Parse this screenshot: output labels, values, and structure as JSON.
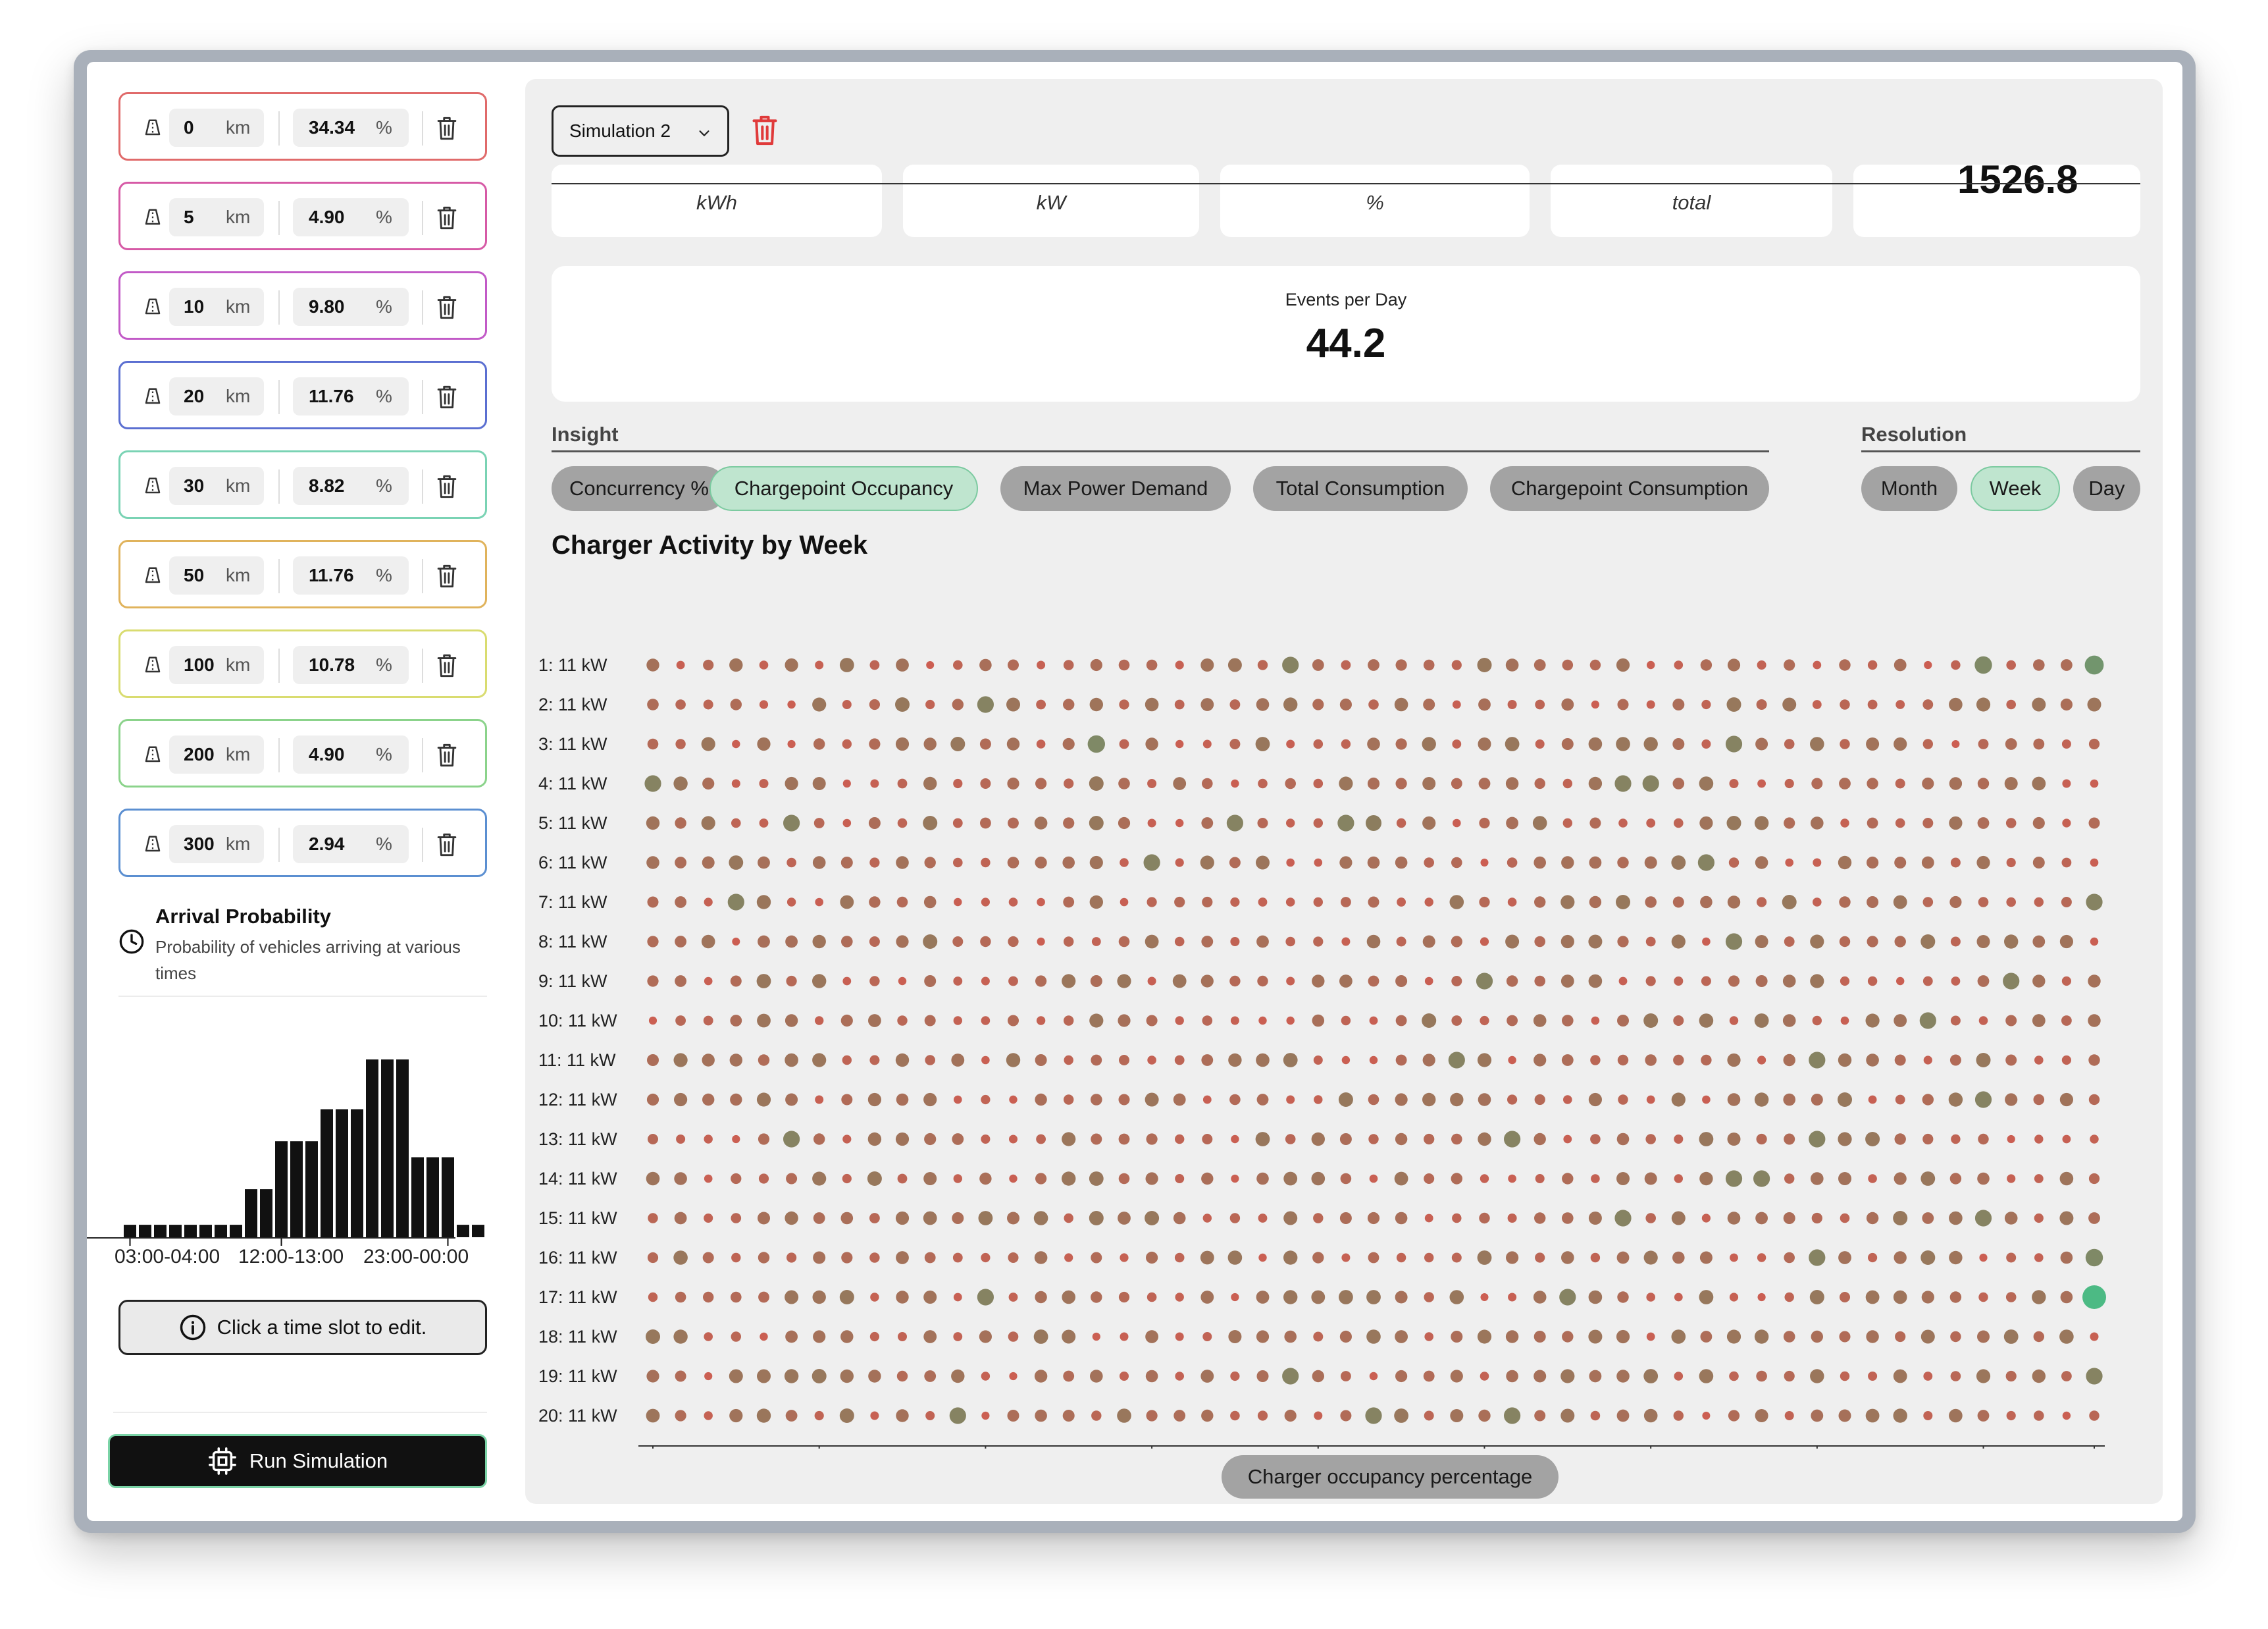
{
  "sidebar": {
    "distance_unit": "km",
    "percent_unit": "%",
    "distances": [
      {
        "km": "0",
        "pct": "34.34",
        "color": "#e06a6a"
      },
      {
        "km": "5",
        "pct": "4.90",
        "color": "#d65aa6"
      },
      {
        "km": "10",
        "pct": "9.80",
        "color": "#c25ac7"
      },
      {
        "km": "20",
        "pct": "11.76",
        "color": "#5b6fd1"
      },
      {
        "km": "30",
        "pct": "8.82",
        "color": "#7ad3b4"
      },
      {
        "km": "50",
        "pct": "11.76",
        "color": "#e0b35c"
      },
      {
        "km": "100",
        "pct": "10.78",
        "color": "#d9dc70"
      },
      {
        "km": "200",
        "pct": "4.90",
        "color": "#8bd38b"
      },
      {
        "km": "300",
        "pct": "2.94",
        "color": "#5b8fd1"
      }
    ],
    "arrival": {
      "title": "Arrival Probability",
      "description": "Probability of vehicles arriving at various times",
      "histogram": [
        0.07,
        0.07,
        0.07,
        0.07,
        0.07,
        0.07,
        0.07,
        0.07,
        0.27,
        0.27,
        0.54,
        0.54,
        0.54,
        0.72,
        0.72,
        0.72,
        1.0,
        1.0,
        1.0,
        0.45,
        0.45,
        0.45,
        0.07,
        0.07
      ],
      "tick_labels": [
        "03:00-04:00",
        "12:00-13:00",
        "23:00-00:00"
      ]
    },
    "hint": "Click a time slot to edit.",
    "run_label": "Run Simulation"
  },
  "main": {
    "simulation_select": "Simulation 2",
    "kpis": [
      "kWh",
      "kW",
      "%",
      "total"
    ],
    "kpi_big": "1526.8",
    "events": {
      "label": "Events per Day",
      "value": "44.2"
    },
    "insight": {
      "title": "Insight",
      "options": [
        "Concurrency %",
        "Chargepoint Occupancy",
        "Max Power Demand",
        "Total Consumption",
        "Chargepoint Consumption"
      ],
      "active": "Chargepoint Occupancy"
    },
    "resolution": {
      "title": "Resolution",
      "options": [
        "Month",
        "Week",
        "Day"
      ],
      "active": "Week"
    },
    "legend_label": "Charger occupancy percentage"
  },
  "chart_data": {
    "type": "scatter",
    "title": "Charger Activity by Week",
    "xlabel": "Week",
    "ylabel": "",
    "x_range": [
      1,
      53
    ],
    "x_ticks": [
      1,
      7,
      13,
      19,
      25,
      31,
      37,
      43,
      49,
      53
    ],
    "rows": [
      "1: 11 kW",
      "2: 11 kW",
      "3: 11 kW",
      "4: 11 kW",
      "5: 11 kW",
      "6: 11 kW",
      "7: 11 kW",
      "8: 11 kW",
      "9: 11 kW",
      "10: 11 kW",
      "11: 11 kW",
      "12: 11 kW",
      "13: 11 kW",
      "14: 11 kW",
      "15: 11 kW",
      "16: 11 kW",
      "17: 11 kW",
      "18: 11 kW",
      "19: 11 kW",
      "20: 11 kW"
    ],
    "colors": {
      "low": "#cc5e52",
      "mid": "#8c7d5e",
      "high": "#4cba84"
    },
    "highlights": [
      {
        "row": 1,
        "week": 53,
        "level": 0.7
      },
      {
        "row": 1,
        "week": 49,
        "level": 0.6
      },
      {
        "row": 1,
        "week": 24,
        "level": 0.55
      },
      {
        "row": 2,
        "week": 13,
        "level": 0.55
      },
      {
        "row": 3,
        "week": 17,
        "level": 0.6
      },
      {
        "row": 3,
        "week": 40,
        "level": 0.55
      },
      {
        "row": 4,
        "week": 1,
        "level": 0.55
      },
      {
        "row": 4,
        "week": 36,
        "level": 0.55
      },
      {
        "row": 4,
        "week": 37,
        "level": 0.55
      },
      {
        "row": 5,
        "week": 6,
        "level": 0.55
      },
      {
        "row": 5,
        "week": 22,
        "level": 0.55
      },
      {
        "row": 5,
        "week": 26,
        "level": 0.55
      },
      {
        "row": 5,
        "week": 27,
        "level": 0.5
      },
      {
        "row": 6,
        "week": 19,
        "level": 0.55
      },
      {
        "row": 6,
        "week": 39,
        "level": 0.55
      },
      {
        "row": 7,
        "week": 4,
        "level": 0.55
      },
      {
        "row": 7,
        "week": 53,
        "level": 0.55
      },
      {
        "row": 8,
        "week": 40,
        "level": 0.55
      },
      {
        "row": 9,
        "week": 31,
        "level": 0.55
      },
      {
        "row": 9,
        "week": 50,
        "level": 0.55
      },
      {
        "row": 10,
        "week": 47,
        "level": 0.55
      },
      {
        "row": 11,
        "week": 30,
        "level": 0.55
      },
      {
        "row": 11,
        "week": 43,
        "level": 0.55
      },
      {
        "row": 12,
        "week": 49,
        "level": 0.55
      },
      {
        "row": 13,
        "week": 6,
        "level": 0.55
      },
      {
        "row": 13,
        "week": 32,
        "level": 0.55
      },
      {
        "row": 13,
        "week": 43,
        "level": 0.55
      },
      {
        "row": 14,
        "week": 40,
        "level": 0.55
      },
      {
        "row": 14,
        "week": 41,
        "level": 0.55
      },
      {
        "row": 15,
        "week": 36,
        "level": 0.55
      },
      {
        "row": 15,
        "week": 49,
        "level": 0.55
      },
      {
        "row": 16,
        "week": 43,
        "level": 0.55
      },
      {
        "row": 16,
        "week": 53,
        "level": 0.6
      },
      {
        "row": 17,
        "week": 13,
        "level": 0.55
      },
      {
        "row": 17,
        "week": 34,
        "level": 0.55
      },
      {
        "row": 17,
        "week": 53,
        "level": 1.0
      },
      {
        "row": 19,
        "week": 24,
        "level": 0.55
      },
      {
        "row": 19,
        "week": 53,
        "level": 0.55
      },
      {
        "row": 20,
        "week": 12,
        "level": 0.55
      },
      {
        "row": 20,
        "week": 27,
        "level": 0.55
      },
      {
        "row": 20,
        "week": 32,
        "level": 0.55
      }
    ]
  }
}
